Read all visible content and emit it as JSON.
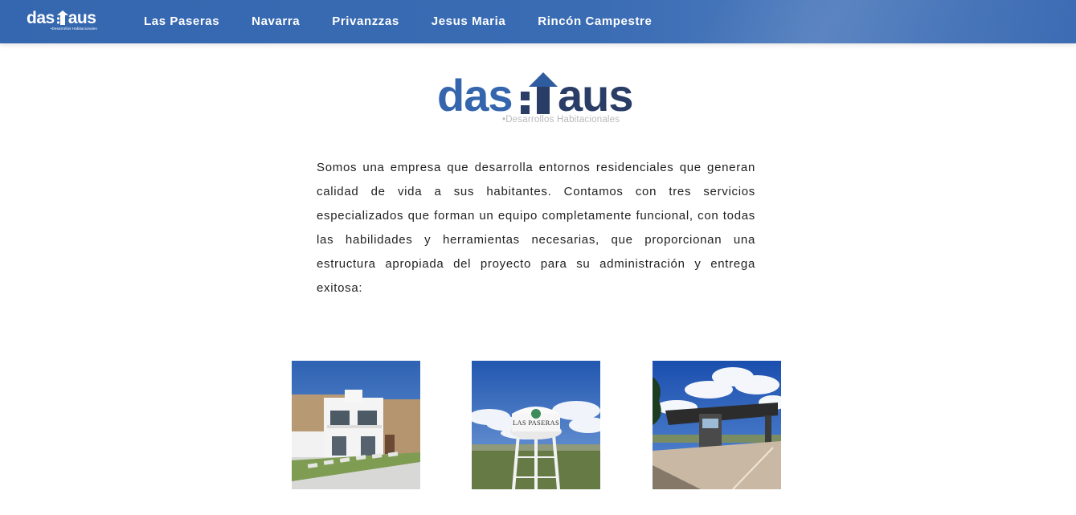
{
  "navbar": {
    "logo_text": "das:haus",
    "logo_subtitle": "•Desarrollos Habitacionales",
    "links": [
      {
        "label": "Las Paseras"
      },
      {
        "label": "Navarra"
      },
      {
        "label": "Privanzzas"
      },
      {
        "label": "Jesus Maria"
      },
      {
        "label": "Rincón Campestre"
      }
    ]
  },
  "brand": {
    "logo_text": "das:haus",
    "subtitle": "•Desarrollos Habitacionales",
    "colors": {
      "primary_blue": "#3565ad",
      "arrow_blue": "#2f5c9e",
      "dark_navy": "#2a3d66",
      "subtitle_gray": "#b8b9bc"
    }
  },
  "intro": {
    "text": "Somos una empresa que desarrolla entornos residenciales que generan calidad de vida a sus habitantes. Contamos con tres servicios especializados que forman un equipo completamente funcional, con todas las habilidades y herramientas necesarias, que proporcionan una estructura apropiada del proyecto para su administración y entrega exitosa:"
  },
  "gallery": {
    "photos": [
      {
        "subject": "two-story white townhouses"
      },
      {
        "subject": "water tower",
        "sign_text": "LAS PASERAS"
      },
      {
        "subject": "entrance gate canopy"
      }
    ]
  }
}
